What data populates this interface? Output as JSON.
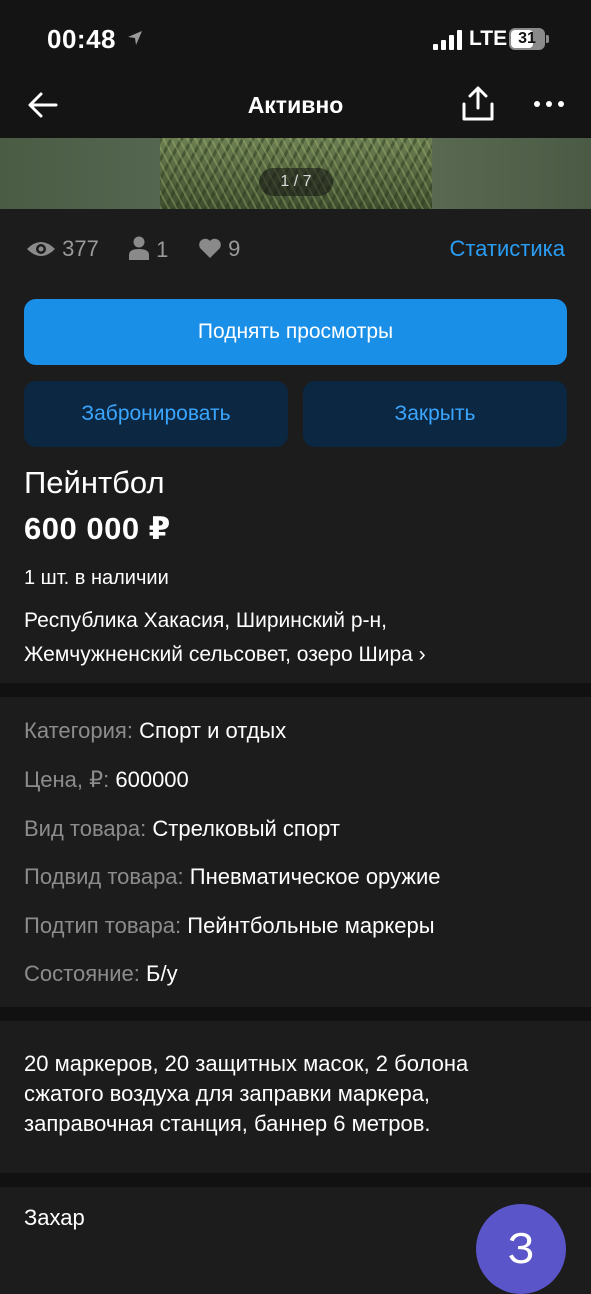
{
  "status_bar": {
    "time": "00:48",
    "network": "LTE",
    "battery": "31"
  },
  "header": {
    "title": "Активно"
  },
  "photo": {
    "counter": "1 / 7"
  },
  "stats": {
    "views": "377",
    "contacts": "1",
    "favorites": "9",
    "statistics_link": "Статистика"
  },
  "buttons": {
    "boost": "Поднять просмотры",
    "reserve": "Забронировать",
    "close": "Закрыть"
  },
  "listing": {
    "title": "Пейнтбол",
    "price": "600 000 ₽",
    "stock": "1 шт. в наличии",
    "address_line1": "Республика Хакасия, Ширинский р-н,",
    "address_line2": "Жемчужненский сельсовет, озеро Шира ›"
  },
  "params": [
    {
      "key": "Категория:",
      "value": "Спорт и отдых"
    },
    {
      "key": "Цена, ₽:",
      "value": "600000"
    },
    {
      "key": "Вид товара:",
      "value": "Стрелковый спорт"
    },
    {
      "key": "Подвид товара:",
      "value": "Пневматическое оружие"
    },
    {
      "key": "Подтип товара:",
      "value": "Пейнтбольные маркеры"
    },
    {
      "key": "Состояние:",
      "value": "Б/у"
    }
  ],
  "description": {
    "line1": "20 маркеров, 20 защитных масок, 2 болона",
    "line2": "сжатого воздуха для заправки маркера,",
    "line3": "заправочная станция, баннер 6 метров."
  },
  "seller": {
    "name": "Захар",
    "avatar_letter": "З"
  },
  "colors": {
    "accent": "#1a8fe8",
    "link": "#2a9df4",
    "secondary_button": "#0b2742",
    "avatar": "#5a55c8"
  },
  "icons": [
    "location-arrow-icon",
    "signal-icon",
    "battery-icon",
    "back-arrow-icon",
    "share-icon",
    "more-icon",
    "eye-icon",
    "person-icon",
    "heart-icon"
  ]
}
